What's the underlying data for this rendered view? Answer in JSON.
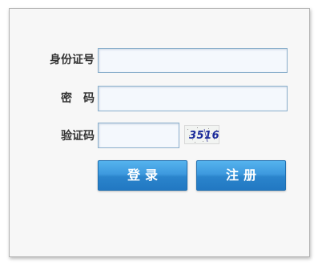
{
  "form": {
    "id_label": "身份证号",
    "id_value": "",
    "password_label": "密　码",
    "password_value": "",
    "captcha_label": "验证码",
    "captcha_value": "",
    "captcha_text": "3516"
  },
  "buttons": {
    "login": "登录",
    "register": "注册"
  },
  "colors": {
    "button_blue": "#2f8ed6",
    "captcha_text": "#1a2a9a",
    "field_border": "#8cb0cc"
  }
}
